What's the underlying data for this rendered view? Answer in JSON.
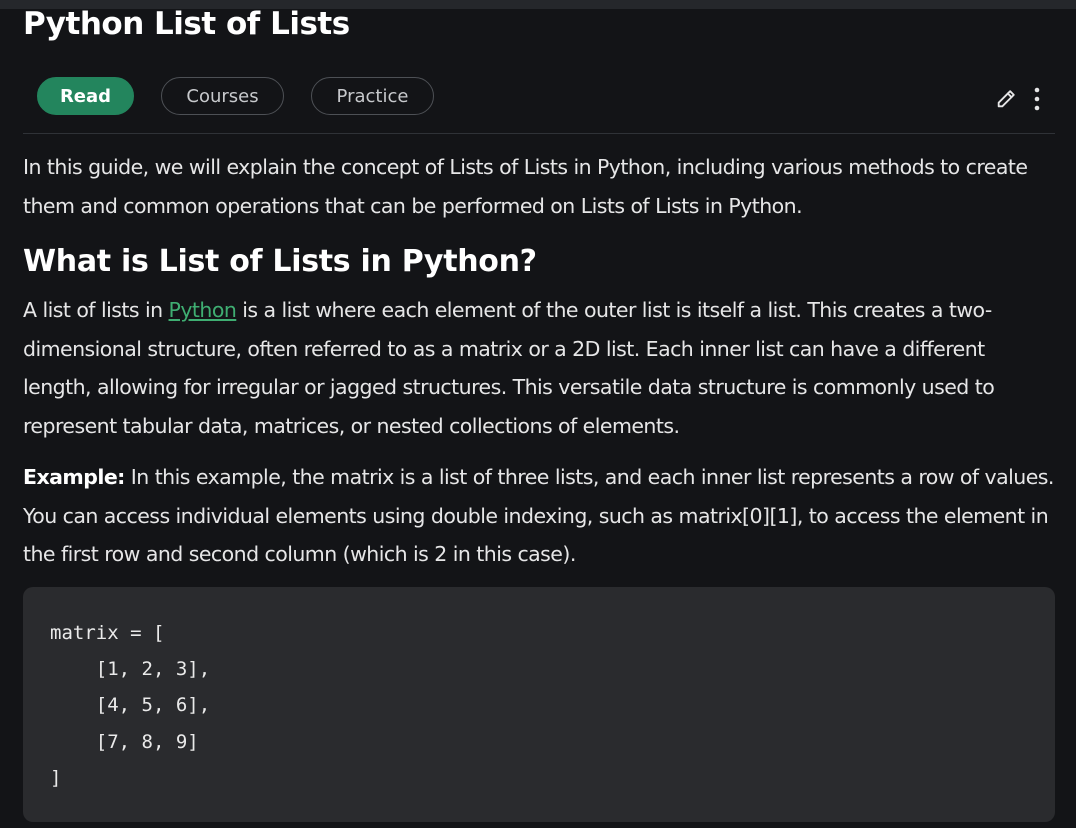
{
  "page": {
    "title": "Python List of Lists"
  },
  "tabs": [
    {
      "label": "Read",
      "active": true
    },
    {
      "label": "Courses",
      "active": false
    },
    {
      "label": "Practice",
      "active": false
    }
  ],
  "actions": {
    "edit_icon": "pencil-icon",
    "more_icon": "vertical-ellipsis-icon"
  },
  "content": {
    "intro": "In this guide, we will explain the concept of Lists of Lists in Python, including various methods to create them and common operations that can be performed on Lists of Lists in Python.",
    "section_heading": "What is List of Lists in Python?",
    "body1_prefix": "A list of lists in ",
    "body1_link": "Python",
    "body1_suffix": " is a list where each element of the outer list is itself a list. This creates a two-dimensional structure, often referred to as a matrix or a 2D list. Each inner list can have a different length, allowing for irregular or jagged structures. This versatile data structure is commonly used to represent tabular data, matrices, or nested collections of elements.",
    "example_label": "Example:",
    "example_text": " In this example, the matrix is a list of three lists, and each inner list represents a row of values. You can access individual elements using double indexing, such as matrix[0][1], to access the element in the first row and second column (which is 2 in this case).",
    "code": "matrix = [\n    [1, 2, 3],\n    [4, 5, 6],\n    [7, 8, 9]\n]"
  },
  "colors": {
    "background": "#131417",
    "accent_green": "#23855d",
    "link_green": "#3fae72",
    "code_bg": "#2a2b2e"
  }
}
